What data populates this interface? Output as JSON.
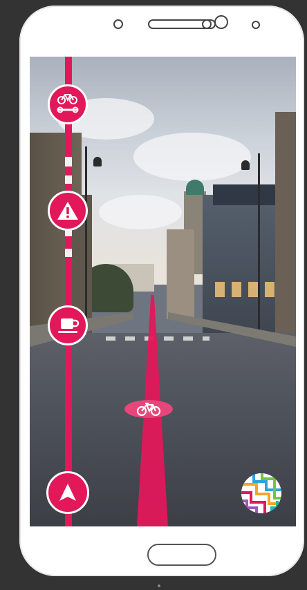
{
  "device": {
    "type": "android-phone"
  },
  "camera_view": {
    "scene": "street-ar-view"
  },
  "route_line": {
    "color": "#e2185b"
  },
  "poi_markers": [
    {
      "icon": "bike-repair-icon"
    },
    {
      "icon": "warning-icon"
    },
    {
      "icon": "coffee-icon"
    }
  ],
  "navigate_button": {
    "icon": "navigation-arrow-icon"
  },
  "lane_marker": {
    "icon": "bicycle-icon"
  },
  "map_button": {
    "icon": "transit-map-icon"
  },
  "colors": {
    "accent": "#e2185b",
    "background": "#333333",
    "phone": "#ffffff"
  }
}
